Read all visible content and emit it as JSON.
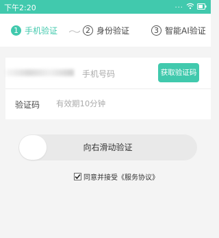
{
  "status_bar": {
    "time": "下午2:20",
    "dots": "...",
    "bg_color": "#41c9ad"
  },
  "steps": [
    {
      "number": "1",
      "label": "手机验证"
    },
    {
      "number": "2",
      "label": "身份验证"
    },
    {
      "number": "3",
      "label": "智能AI验证"
    }
  ],
  "phone": {
    "placeholder": "手机号码",
    "get_code_label": "获取验证码"
  },
  "code": {
    "label": "验证码",
    "placeholder": "有效期10分钟"
  },
  "slider": {
    "label": "向右滑动验证",
    "progress": 0
  },
  "agreement": {
    "checked": true,
    "text": "同意并接受《服务协议》"
  },
  "colors": {
    "accent": "#41c9ad",
    "background": "#f4f4f4"
  }
}
